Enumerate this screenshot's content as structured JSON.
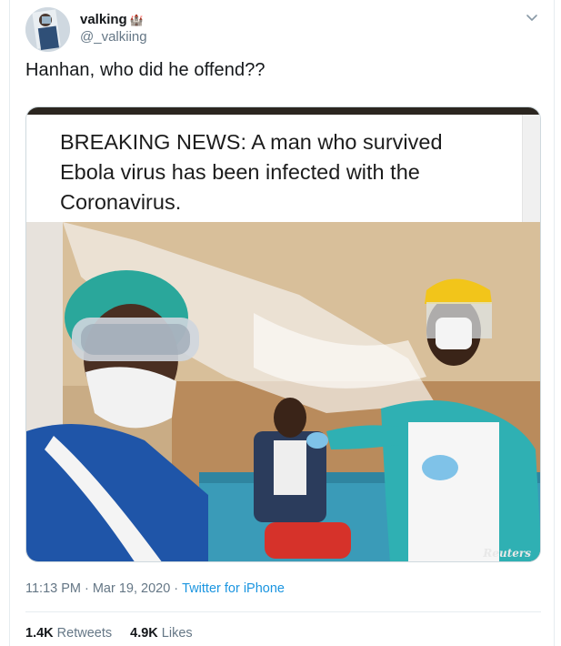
{
  "user": {
    "display_name": "valking",
    "badge_glyph": "🏰",
    "handle": "@_valkiing"
  },
  "tweet": {
    "text": "Hanhan, who did he offend??"
  },
  "media": {
    "headline": "BREAKING NEWS: A man who survived Ebola virus has been infected with the Coronavirus.",
    "watermark": "Reuters"
  },
  "meta": {
    "time": "11:13 PM",
    "separator1": "·",
    "date": "Mar 19, 2020",
    "separator2": "·",
    "source": "Twitter for iPhone"
  },
  "stats": {
    "retweets_count": "1.4K",
    "retweets_label": "Retweets",
    "likes_count": "4.9K",
    "likes_label": "Likes"
  },
  "icons": {
    "caret": "chevron-down-icon"
  },
  "colors": {
    "accent": "#1b95e0",
    "secondary_text": "#657786",
    "primary_text": "#14171a"
  }
}
